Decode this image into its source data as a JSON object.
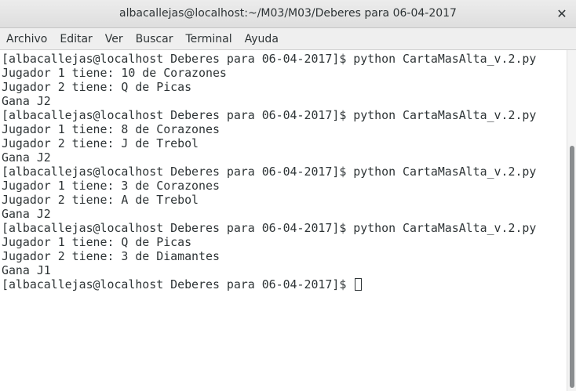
{
  "window": {
    "title": "albacallejas@localhost:~/M03/M03/Deberes para 06-04-2017",
    "close_icon": "close-icon"
  },
  "menu": {
    "items": [
      "Archivo",
      "Editar",
      "Ver",
      "Buscar",
      "Terminal",
      "Ayuda"
    ]
  },
  "terminal": {
    "lines": [
      "[albacallejas@localhost Deberes para 06-04-2017]$ python CartaMasAlta_v.2.py",
      "Jugador 1 tiene: 10 de Corazones",
      "Jugador 2 tiene: Q de Picas",
      "Gana J2",
      "[albacallejas@localhost Deberes para 06-04-2017]$ python CartaMasAlta_v.2.py",
      "Jugador 1 tiene: 8 de Corazones",
      "Jugador 2 tiene: J de Trebol",
      "Gana J2",
      "[albacallejas@localhost Deberes para 06-04-2017]$ python CartaMasAlta_v.2.py",
      "Jugador 1 tiene: 3 de Corazones",
      "Jugador 2 tiene: A de Trebol",
      "Gana J2",
      "[albacallejas@localhost Deberes para 06-04-2017]$ python CartaMasAlta_v.2.py",
      "Jugador 1 tiene: Q de Picas",
      "Jugador 2 tiene: 3 de Diamantes",
      "Gana J1"
    ],
    "prompt": "[albacallejas@localhost Deberes para 06-04-2017]$ "
  }
}
